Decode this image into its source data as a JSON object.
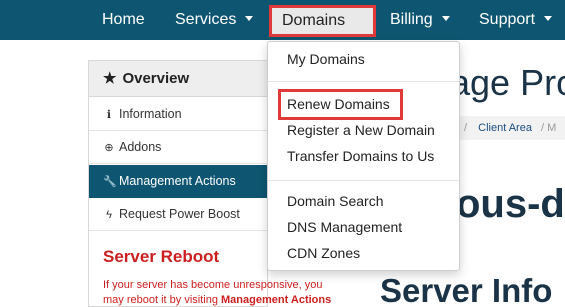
{
  "nav": {
    "items": [
      {
        "label": "Home"
      },
      {
        "label": "Services"
      },
      {
        "label": "Domains"
      },
      {
        "label": "Billing"
      },
      {
        "label": "Support"
      }
    ]
  },
  "dropdown": {
    "group1": [
      "My Domains"
    ],
    "group2": [
      "Renew Domains",
      "Register a New Domain",
      "Transfer Domains to Us"
    ],
    "group3": [
      "Domain Search",
      "DNS Management",
      "CDN Zones"
    ]
  },
  "sidebar": {
    "title": "Overview",
    "items": [
      {
        "label": "Information",
        "icon": "info-circle-icon"
      },
      {
        "label": "Addons",
        "icon": "plus-circle-icon"
      },
      {
        "label": "Management Actions",
        "icon": "wrench-icon"
      },
      {
        "label": "Request Power Boost",
        "icon": "bolt-icon"
      }
    ],
    "reboot_title": "Server Reboot",
    "reboot_text_prefix": "If your server has become unresponsive, you may reboot it by visiting ",
    "reboot_text_link": "Management Actions"
  },
  "main": {
    "heading": "age Pro",
    "breadcrumb_sep": "/",
    "breadcrumb_link": "Client Area",
    "breadcrumb_tail": "/ M",
    "hostname": "ous-de",
    "section_title": "Server Info"
  },
  "colors": {
    "navbar": "#0e5571",
    "highlight_border": "#e0393a",
    "reboot_red": "#cc1f1f",
    "heading": "#1a3346"
  }
}
